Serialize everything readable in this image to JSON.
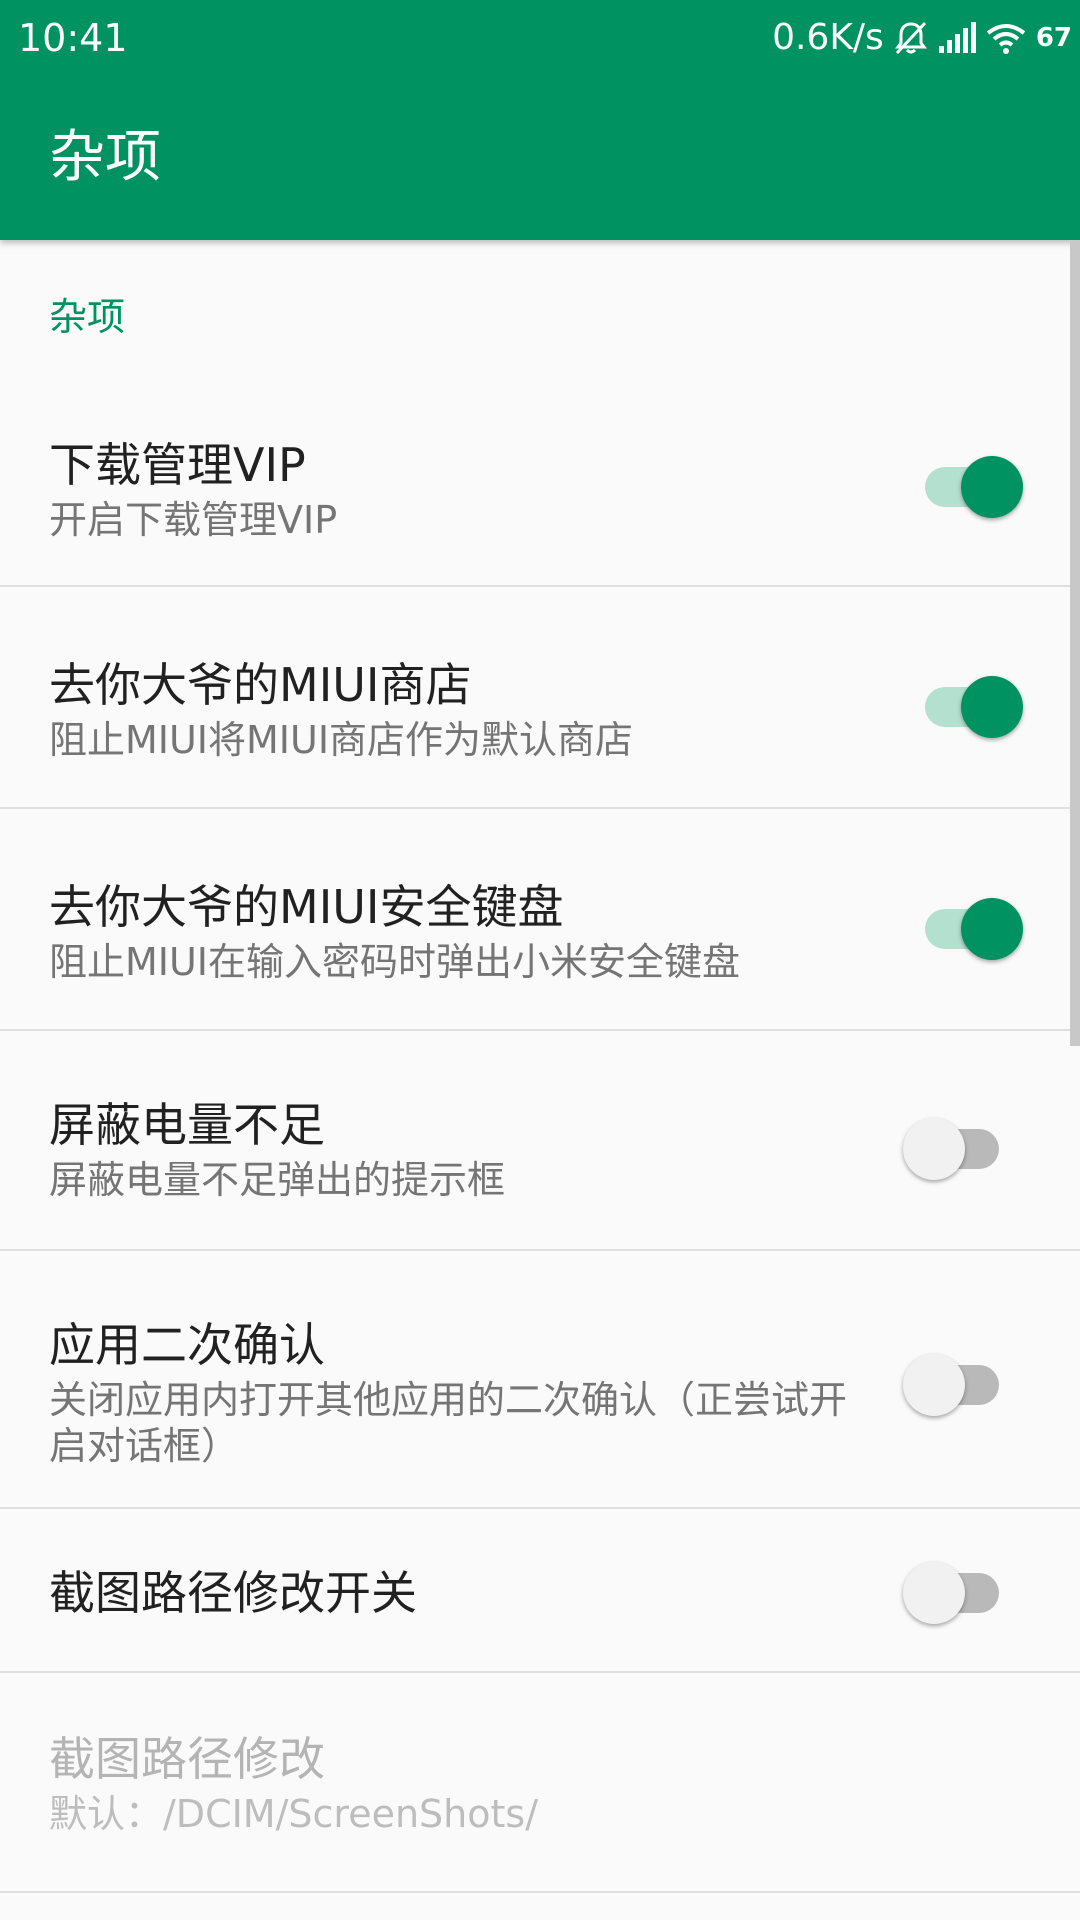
{
  "status_bar": {
    "time": "10:41",
    "net_speed": "0.6K/s",
    "battery": "67",
    "icons": [
      "bell-muted-icon",
      "signal-icon",
      "wifi-icon",
      "battery-icon"
    ]
  },
  "app_bar": {
    "title": "杂项"
  },
  "colors": {
    "primary": "#009260",
    "switch_track_on": "#b3e0cf",
    "switch_track_off": "#b9b9b9",
    "background": "#fafafa"
  },
  "section": {
    "header": "杂项"
  },
  "settings": [
    {
      "title": "下载管理VIP",
      "summary": "开启下载管理VIP",
      "checked": true
    },
    {
      "title": "去你大爷的MIUI商店",
      "summary": "阻止MIUI将MIUI商店作为默认商店",
      "checked": true
    },
    {
      "title": "去你大爷的MIUI安全键盘",
      "summary": "阻止MIUI在输入密码时弹出小米安全键盘",
      "checked": true
    },
    {
      "title": "屏蔽电量不足",
      "summary": "屏蔽电量不足弹出的提示框",
      "checked": false
    },
    {
      "title": "应用二次确认",
      "summary": "关闭应用内打开其他应用的二次确认（正尝试开启对话框）",
      "checked": false
    },
    {
      "title": "截图路径修改开关",
      "checked": false
    }
  ],
  "screenshot_path": {
    "title": "截图路径修改",
    "summary": "默认：/DCIM/ScreenShots/",
    "enabled": false
  }
}
